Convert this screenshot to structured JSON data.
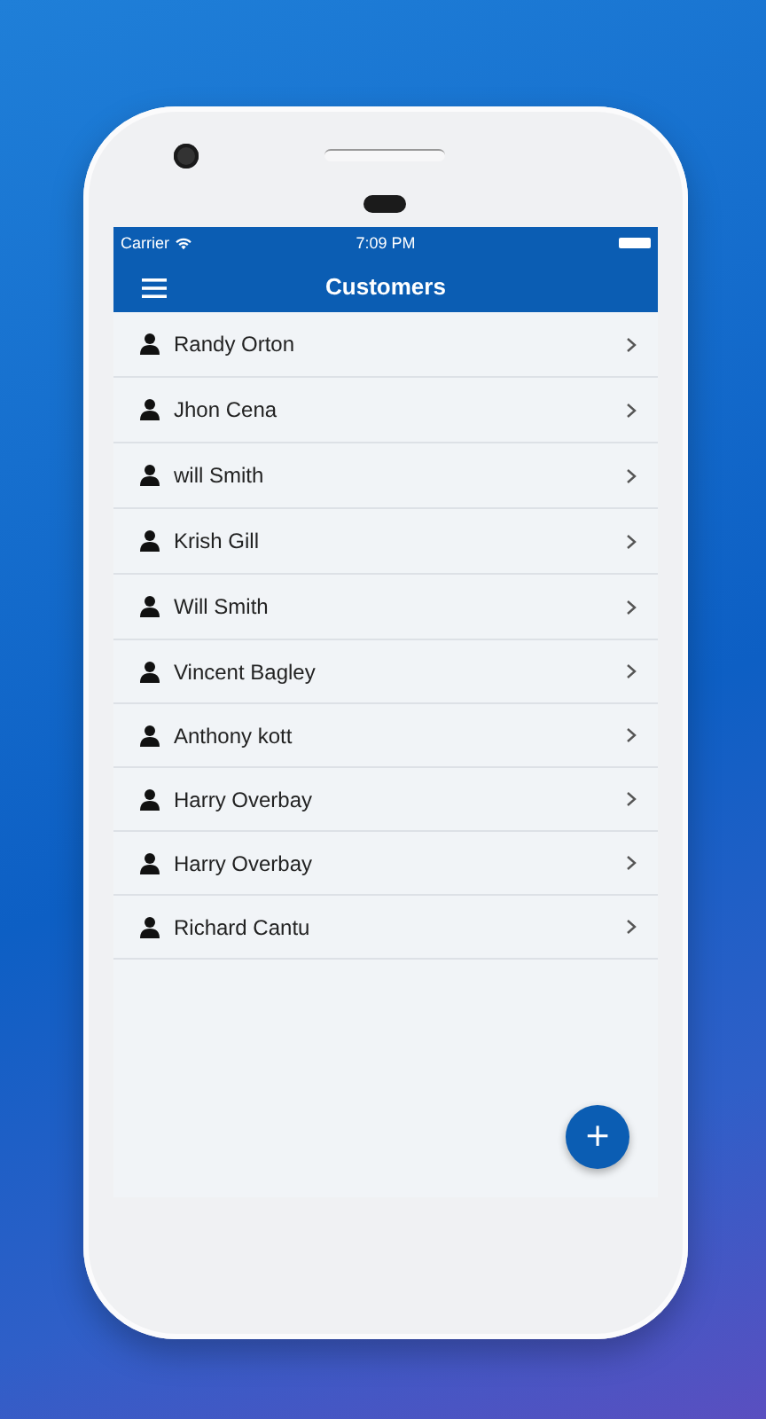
{
  "status_bar": {
    "carrier": "Carrier",
    "time": "7:09 PM"
  },
  "nav_bar": {
    "title": "Customers"
  },
  "customers": [
    {
      "name": "Randy Orton"
    },
    {
      "name": "Jhon Cena"
    },
    {
      "name": "will Smith"
    },
    {
      "name": "Krish Gill"
    },
    {
      "name": "Will Smith"
    },
    {
      "name": "Vincent Bagley"
    },
    {
      "name": "Anthony kott"
    },
    {
      "name": "Harry Overbay"
    },
    {
      "name": "Harry Overbay"
    },
    {
      "name": "Richard Cantu"
    }
  ],
  "fab": {
    "label": "+"
  }
}
